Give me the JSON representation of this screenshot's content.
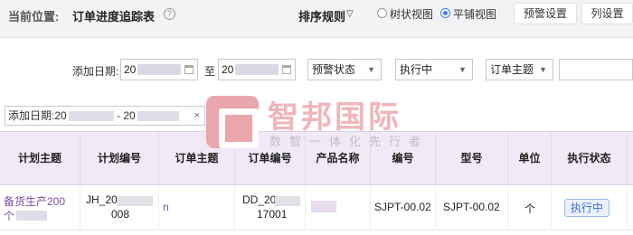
{
  "breadcrumb": {
    "label": "当前位置:",
    "title": "订单进度追踪表",
    "help_icon": "question-circle-icon"
  },
  "toolbar": {
    "sort_label": "排序规则",
    "view_options": [
      {
        "label": "树状视图",
        "selected": false
      },
      {
        "label": "平铺视图",
        "selected": true
      }
    ],
    "warning_settings_label": "预警设置",
    "column_settings_label": "列设置"
  },
  "filters": {
    "date_label": "添加日期:",
    "date_from": "20",
    "date_to": "20",
    "range_sep": "至",
    "warning_status": "预警状态",
    "exec_status": "执行中",
    "order_subject": "订单主题",
    "search": ""
  },
  "active_filter_tag": {
    "prefix": "添加日期:20",
    "middle": " - 20",
    "close": "×"
  },
  "table": {
    "columns": [
      "计划主题",
      "计划编号",
      "订单主题",
      "订单编号",
      "产品名称",
      "编号",
      "型号",
      "单位",
      "执行状态"
    ],
    "rows": [
      {
        "plan_subject_l1": "备货生产200",
        "plan_subject_l2": "个",
        "plan_no_l1": "JH_20",
        "plan_no_l2": "008",
        "order_subject": "n",
        "order_no_l1": "DD_20",
        "order_no_l2": "17001",
        "product_name": "",
        "code": "SJPT-00.02",
        "model": "SJPT-00.02",
        "unit": "个",
        "status": "执行中"
      }
    ]
  },
  "watermark": {
    "brand": "智邦国际",
    "slogan": "数智一体化先行者"
  },
  "colors": {
    "header_bg": "#f1e9f5",
    "accent": "#3b7cf4",
    "link_purple": "#7b4ea3",
    "status_blue": "#3b6fd6"
  }
}
